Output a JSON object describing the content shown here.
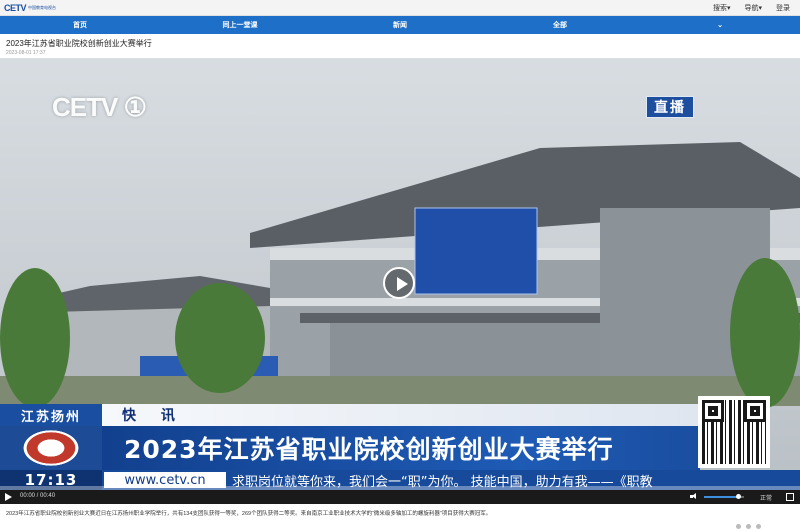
{
  "header": {
    "logo_mark": "CETV",
    "logo_sub": "中国教育电视台",
    "search": "搜索▾",
    "guide": "导航▾",
    "login": "登录"
  },
  "nav": [
    {
      "label": "首页"
    },
    {
      "label": "同上一堂课"
    },
    {
      "label": "新闻"
    },
    {
      "label": "全部"
    },
    {
      "label": "⌄"
    }
  ],
  "article": {
    "title": "2023年江苏省职业院校创新创业大赛举行",
    "date": "2023-08-01 17:37",
    "caption": "2023年江苏省职业院校创新创业大赛近日在江苏扬州职业学院举行，共有134支团队获得一等奖，269个团队获得二等奖。来自南京工业职业技术大学的“微米级多轴加工的螺旋利器”项目获得大赛冠军。"
  },
  "video": {
    "channel_logo": "CETV ①",
    "live_badge": "直播",
    "location": "江苏扬州",
    "flash_label": "快 讯",
    "headline": "2023年江苏省职业院校创新创业大赛举行",
    "clock": "17:13",
    "url": "www.cetv.cn",
    "ticker": "求职岗位就等你来，我们会一“职”为你。    技能中国，助力有我——《职教",
    "time_display": "00:00 / 00:40",
    "speed": "正常",
    "progress": 0.0,
    "volume": 0.85
  },
  "colors": {
    "nav_blue": "#1e6fc8",
    "broadcast_blue": "#1a4ea0"
  }
}
